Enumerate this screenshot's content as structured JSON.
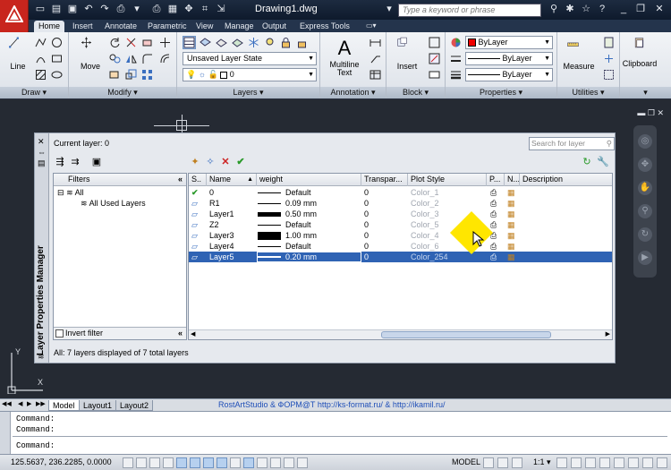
{
  "app": {
    "doc_title": "Drawing1.dwg",
    "search_placeholder": "Type a keyword or phrase"
  },
  "tabs": [
    {
      "label": "Home"
    },
    {
      "label": "Insert"
    },
    {
      "label": "Annotate"
    },
    {
      "label": "Parametric"
    },
    {
      "label": "View"
    },
    {
      "label": "Manage"
    },
    {
      "label": "Output"
    },
    {
      "label": "Express Tools"
    }
  ],
  "ribbon": {
    "draw": {
      "title": "Draw",
      "line_label": "Line"
    },
    "modify": {
      "title": "Modify",
      "move_label": "Move"
    },
    "layers": {
      "title": "Layers",
      "layer_state": "Unsaved Layer State",
      "current_layer": "0"
    },
    "annotation": {
      "title": "Annotation",
      "mtext_label": "Multiline Text",
      "mtext_line1": "Multiline",
      "mtext_line2": "Text"
    },
    "block": {
      "title": "Block",
      "insert_label": "Insert"
    },
    "properties": {
      "title": "Properties",
      "color": "ByLayer",
      "linetype": "ByLayer",
      "lineweight": "ByLayer"
    },
    "utilities": {
      "title": "Utilities",
      "measure_label": "Measure"
    },
    "clipboard": {
      "title": "Clipboard",
      "label": "Clipboard"
    }
  },
  "lpm": {
    "side_title": "Layer Properties Manager",
    "current_layer": "Current layer: 0",
    "search_placeholder": "Search for layer",
    "filters_header": "Filters",
    "filter_all": "All",
    "filter_used": "All Used Layers",
    "invert_filter": "Invert filter",
    "status": "All: 7 layers displayed of 7 total layers",
    "columns": {
      "status": "S..",
      "name": "Name",
      "weight": "weight",
      "transparency": "Transpar...",
      "plot_style": "Plot Style",
      "plot": "P...",
      "new_vp": "N...",
      "description": "Description"
    },
    "rows": [
      {
        "current": true,
        "name": "0",
        "lineweight": "Default",
        "lw_val": 0,
        "transparency": "0",
        "plot_style": "Color_1",
        "selected": false
      },
      {
        "current": false,
        "name": "R1",
        "lineweight": "0.09 mm",
        "lw_val": 0.09,
        "transparency": "0",
        "plot_style": "Color_2",
        "selected": false
      },
      {
        "current": false,
        "name": "Layer1",
        "lineweight": "0.50 mm",
        "lw_val": 0.5,
        "transparency": "0",
        "plot_style": "Color_3",
        "selected": false
      },
      {
        "current": false,
        "name": "Z2",
        "lineweight": "Default",
        "lw_val": 0,
        "transparency": "0",
        "plot_style": "Color_5",
        "selected": false
      },
      {
        "current": false,
        "name": "Layer3",
        "lineweight": "1.00 mm",
        "lw_val": 1.0,
        "transparency": "0",
        "plot_style": "Color_4",
        "selected": false
      },
      {
        "current": false,
        "name": "Layer4",
        "lineweight": "Default",
        "lw_val": 0,
        "transparency": "0",
        "plot_style": "Color_6",
        "selected": false
      },
      {
        "current": false,
        "name": "Layer5",
        "lineweight": "0.20 mm",
        "lw_val": 0.2,
        "transparency": "0",
        "plot_style": "Color_254",
        "selected": true
      }
    ]
  },
  "layout_tabs": [
    {
      "label": "Model"
    },
    {
      "label": "Layout1"
    },
    {
      "label": "Layout2"
    }
  ],
  "credit": "RostArtStudio & ФОРМ@Т http://ks-format.ru/ & http://ikamil.ru/",
  "command_lines": [
    "Command:",
    "Command:",
    "Command:"
  ],
  "status": {
    "coords": "125.5637, 236.2285, 0.0000",
    "model": "MODEL",
    "scale": "1:1"
  },
  "colors": {
    "accent": "#2f63b4",
    "pointer": "#ffe600",
    "brand": "#c8251d"
  }
}
